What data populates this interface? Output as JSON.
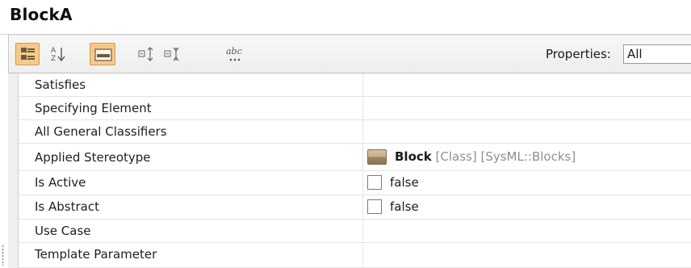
{
  "title": "BlockA",
  "toolbar": {
    "buttons": [
      {
        "icon": "categorized-view-icon",
        "selected": true
      },
      {
        "icon": "sort-alphabetical-icon",
        "selected": false
      },
      {
        "icon": "show-description-icon",
        "selected": true
      },
      {
        "icon": "expand-all-icon",
        "selected": false
      },
      {
        "icon": "collapse-all-icon",
        "selected": false
      },
      {
        "icon": "abbreviations-icon",
        "abc_label": "abc",
        "selected": false
      }
    ],
    "properties_label": "Properties:",
    "properties_value": "All"
  },
  "rows": [
    {
      "name": "Satisfies",
      "value": ""
    },
    {
      "name": "Specifying Element",
      "value": ""
    },
    {
      "name": "All General Classifiers",
      "value": ""
    },
    {
      "name": "Applied Stereotype",
      "stereotype": "Block",
      "stereotype_meta": "[Class] [SysML::Blocks]",
      "icon": "block-stereotype-icon"
    },
    {
      "name": "Is Active",
      "checked": false,
      "value": "false"
    },
    {
      "name": "Is Abstract",
      "checked": false,
      "value": "false"
    },
    {
      "name": "Use Case",
      "value": ""
    },
    {
      "name": "Template Parameter",
      "value": ""
    }
  ],
  "colors": {
    "selected_button_bg": "#f5c98a",
    "selected_button_border": "#d89a45",
    "meta_text": "#8f8f8f"
  }
}
